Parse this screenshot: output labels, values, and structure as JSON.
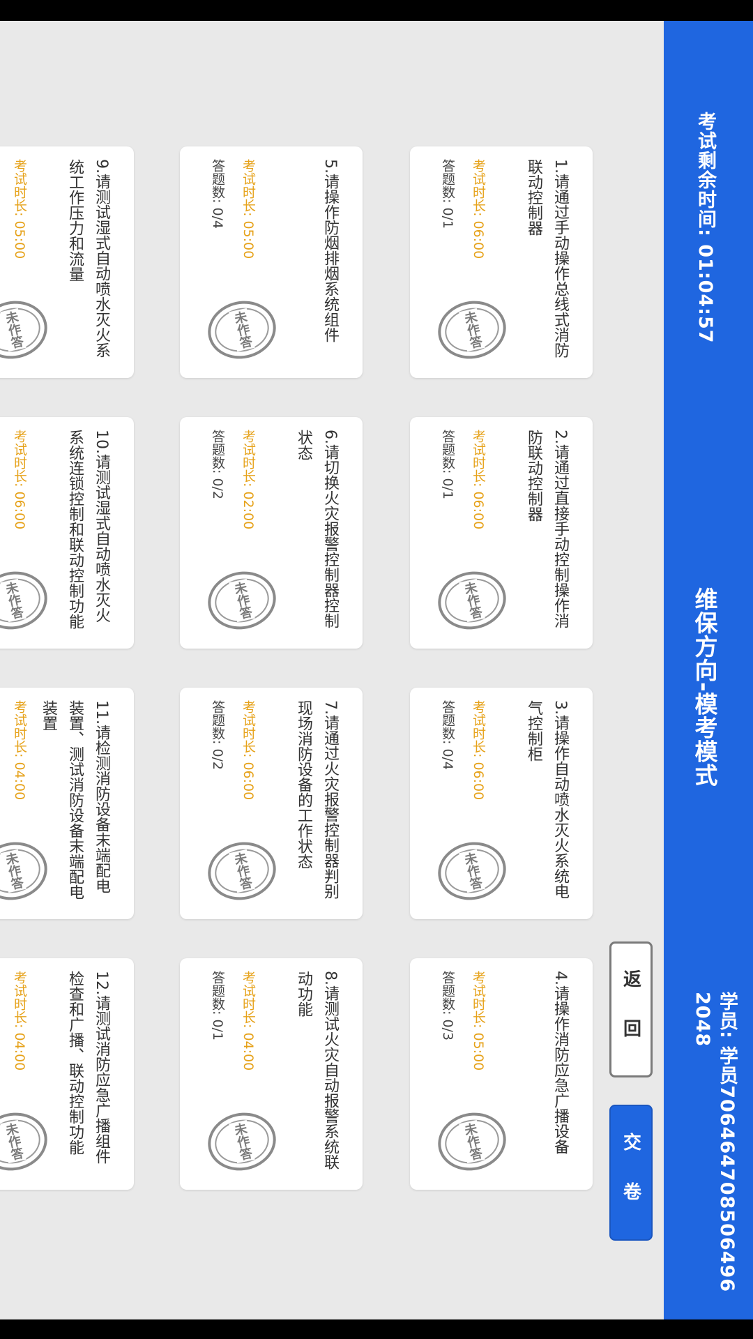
{
  "header": {
    "timer_label": "考试剩余时间: 01:04:57",
    "title": "维保方向-模考模式",
    "student_label": "学员: 学员706464708506496 2048"
  },
  "buttons": {
    "back": "返 回",
    "submit": "交 卷"
  },
  "stamp_text": "未作答",
  "duration_prefix": "考试时长: ",
  "count_prefix": "答题数: ",
  "questions": [
    {
      "text": "1.请通过手动操作总线式消防联动控制器",
      "duration": "06:00",
      "count": "0/1"
    },
    {
      "text": "2.请通过直接手动控制操作消防联动控制器",
      "duration": "06:00",
      "count": "0/1"
    },
    {
      "text": "3.请操作自动喷水灭火系统电气控制柜",
      "duration": "06:00",
      "count": "0/4"
    },
    {
      "text": "4.请操作消防应急广播设备",
      "duration": "05:00",
      "count": "0/3"
    },
    {
      "text": "5.请操作防烟排烟系统组件",
      "duration": "05:00",
      "count": "0/4"
    },
    {
      "text": "6.请切换火灾报警控制器控制状态",
      "duration": "02:00",
      "count": "0/2"
    },
    {
      "text": "7.请通过火灾报警控制器判别现场消防设备的工作状态",
      "duration": "06:00",
      "count": "0/2"
    },
    {
      "text": "8.请测试火灾自动报警系统联动功能",
      "duration": "04:00",
      "count": "0/1"
    },
    {
      "text": "9.请测试湿式自动喷水灭火系统工作压力和流量",
      "duration": "05:00",
      "count": ""
    },
    {
      "text": "10.请测试湿式自动喷水灭火系统连锁控制和联动控制功能",
      "duration": "06:00",
      "count": ""
    },
    {
      "text": "11.请检测消防设备末端配电装置、测试消防设备末端配电装置",
      "duration": "04:00",
      "count": ""
    },
    {
      "text": "12.请测试消防应急广播组件检查和广播、联动控制功能",
      "duration": "04:00",
      "count": ""
    }
  ]
}
